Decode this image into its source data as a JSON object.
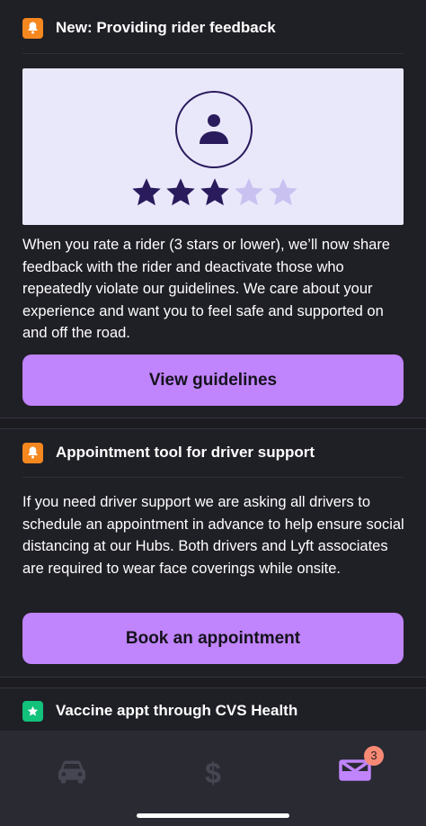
{
  "cards": [
    {
      "title": "New: Providing rider feedback",
      "icon": "bell-icon",
      "icon_color": "#f5871f",
      "rating": {
        "value": 3,
        "max": 5,
        "filled_color": "#2a1b5c",
        "empty_color": "#c9c2f0"
      },
      "body": "When you rate a rider (3 stars or lower), we’ll now share feedback with the rider and deactivate those who repeatedly violate our guidelines. We care about your experience and want you to feel safe and supported on and off the road.",
      "button": "View guidelines"
    },
    {
      "title": "Appointment tool for driver support",
      "icon": "bell-icon",
      "icon_color": "#f5871f",
      "body": "If you need driver support we are asking all drivers to schedule an appointment in advance to help ensure social distancing at our Hubs. Both drivers and Lyft associates are required to wear face coverings while onsite.",
      "button": "Book an appointment"
    },
    {
      "title": "Vaccine appt through CVS Health",
      "icon": "star-icon",
      "icon_color": "#12c17a"
    }
  ],
  "tabbar": {
    "tabs": [
      {
        "name": "drive",
        "icon": "car-icon"
      },
      {
        "name": "earnings",
        "icon": "dollar-icon"
      },
      {
        "name": "inbox",
        "icon": "inbox-icon",
        "badge": "3",
        "active": true
      }
    ],
    "accent": "#c084fc"
  }
}
